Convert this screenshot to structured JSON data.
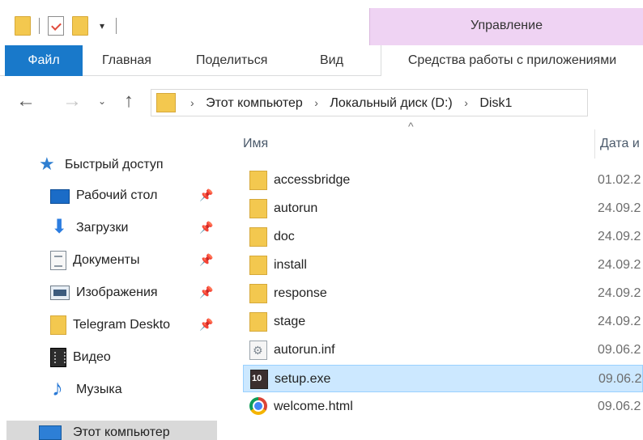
{
  "quick_access_toolbar": {
    "dropdown_glyph": "▾"
  },
  "context_tab_header": "Управление",
  "ribbon": {
    "tabs": [
      {
        "label": "Файл"
      },
      {
        "label": "Главная"
      },
      {
        "label": "Поделиться"
      },
      {
        "label": "Вид"
      },
      {
        "label": "Средства работы с приложениями"
      }
    ]
  },
  "navigation": {
    "breadcrumbs": [
      "Этот компьютер",
      "Локальный диск (D:)",
      "Disk1"
    ]
  },
  "nav_pane": {
    "quick_access_label": "Быстрый доступ",
    "items": [
      {
        "label": "Рабочий стол",
        "icon": "desktop-icon",
        "pinned": true
      },
      {
        "label": "Загрузки",
        "icon": "downloads-icon",
        "pinned": true
      },
      {
        "label": "Документы",
        "icon": "documents-icon",
        "pinned": true
      },
      {
        "label": "Изображения",
        "icon": "pictures-icon",
        "pinned": true
      },
      {
        "label": "Telegram Deskto",
        "icon": "folder-icon",
        "pinned": true
      },
      {
        "label": "Видео",
        "icon": "video-icon",
        "pinned": false
      },
      {
        "label": "Музыка",
        "icon": "music-icon",
        "pinned": false
      }
    ],
    "this_pc_label": "Этот компьютер"
  },
  "file_list": {
    "columns": {
      "name": "Имя",
      "date": "Дата и"
    },
    "files": [
      {
        "name": "accessbridge",
        "date": "01.02.2",
        "icon": "folder-icon",
        "selected": false
      },
      {
        "name": "autorun",
        "date": "24.09.2",
        "icon": "folder-icon",
        "selected": false
      },
      {
        "name": "doc",
        "date": "24.09.2",
        "icon": "folder-icon",
        "selected": false
      },
      {
        "name": "install",
        "date": "24.09.2",
        "icon": "folder-icon",
        "selected": false
      },
      {
        "name": "response",
        "date": "24.09.2",
        "icon": "folder-icon",
        "selected": false
      },
      {
        "name": "stage",
        "date": "24.09.2",
        "icon": "folder-icon",
        "selected": false
      },
      {
        "name": "autorun.inf",
        "date": "09.06.2",
        "icon": "settings-file-icon",
        "selected": false
      },
      {
        "name": "setup.exe",
        "date": "09.06.2",
        "icon": "setup-exe-icon",
        "selected": true
      },
      {
        "name": "welcome.html",
        "date": "09.06.2",
        "icon": "chrome-html-icon",
        "selected": false
      }
    ]
  },
  "colors": {
    "file_tab": "#1979ca",
    "context_header": "#efd3f3",
    "selection": "#cce8ff",
    "folder": "#f3c84f"
  }
}
